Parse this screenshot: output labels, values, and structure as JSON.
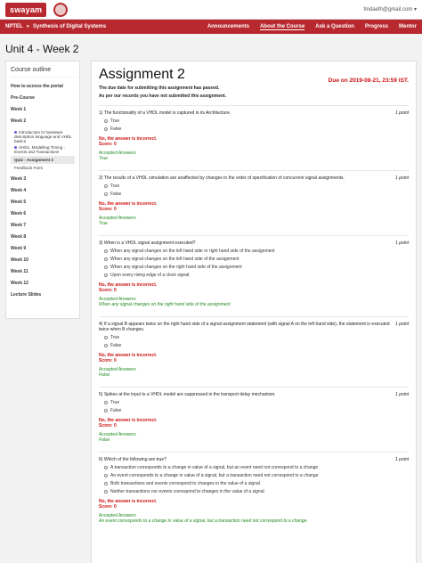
{
  "header": {
    "logo_text": "swayam",
    "user": "tindaeth@gmail.com ▾"
  },
  "nav": {
    "left1": "NPTEL",
    "sep": "»",
    "left2": "Synthesis of Digital Systems",
    "items": [
      "Announcements",
      "About the Course",
      "Ask a Question",
      "Progress",
      "Mentor"
    ]
  },
  "page_title": "Unit 4 - Week 2",
  "sidebar": {
    "title": "Course outline",
    "items": [
      "How to access the portal",
      "Pre-Course",
      "Week 1",
      "Week 2"
    ],
    "subitems": [
      "Introduction to hardware description language and VHDL basics",
      "VHDL: Modelling Timing - Events and Transactions",
      "Quiz : Assignment 2",
      "Feedback Form"
    ],
    "weeks": [
      "Week 3",
      "Week 4",
      "Week 5",
      "Week 6",
      "Week 7",
      "Week 8",
      "Week 9",
      "Week 10",
      "Week 11",
      "Week 12",
      "Lecture Slides"
    ]
  },
  "assignment": {
    "title": "Assignment 2",
    "due": "Due on 2019-08-21, 23:59 IST.",
    "notice1": "The due date for submitting this assignment has passed.",
    "notice2": "As per our records you have not submitted this assignment.",
    "wrong": "No, the answer is incorrect.",
    "score": "Score: 0",
    "accepted": "Accepted Answers:",
    "point": "1 point",
    "questions": [
      {
        "num": "1)",
        "text": "The functionality of a VHDL model is captured in its Architecture.",
        "options": [
          "True",
          "False"
        ],
        "answer": "True"
      },
      {
        "num": "2)",
        "text": "The results of a VHDL simulation are unaffected by changes in the order of specification of concurrent signal assignments.",
        "options": [
          "True",
          "False"
        ],
        "answer": "True"
      },
      {
        "num": "3)",
        "text": "When is a VHDL signal assignment executed?",
        "options": [
          "When any signal changes on the left hand side or right hand side of the assignment",
          "When any signal changes on the left hand side of the assignment",
          "When any signal changes on the right hand side of the assignment",
          "Upon every rising edge of a clock signal"
        ],
        "answer": "When any signal changes on the right hand side of the assignment"
      },
      {
        "num": "4)",
        "text": "If a signal B appears twice on the right hand side of a signal assignment statement (with signal A on the left hand side), the statement is executed twice when B changes.",
        "options": [
          "True",
          "False"
        ],
        "answer": "False"
      },
      {
        "num": "5)",
        "text": "Spikes at the input to a VHDL model are suppressed in the transport delay mechanism.",
        "options": [
          "True",
          "False"
        ],
        "answer": "False"
      },
      {
        "num": "6)",
        "text": "Which of the following are true?",
        "options": [
          "A transaction corresponds to a change in value of a signal, but an event need not correspond to a change",
          "An event corresponds to a change in value of a signal, but a transaction need not correspond to a change",
          "Both transactions and events correspond to changes in the value of a signal",
          "Neither transactions nor events correspond to changes in the value of a signal"
        ],
        "answer": "An event corresponds to a change in value of a signal, but a transaction need not correspond to a change"
      }
    ]
  }
}
